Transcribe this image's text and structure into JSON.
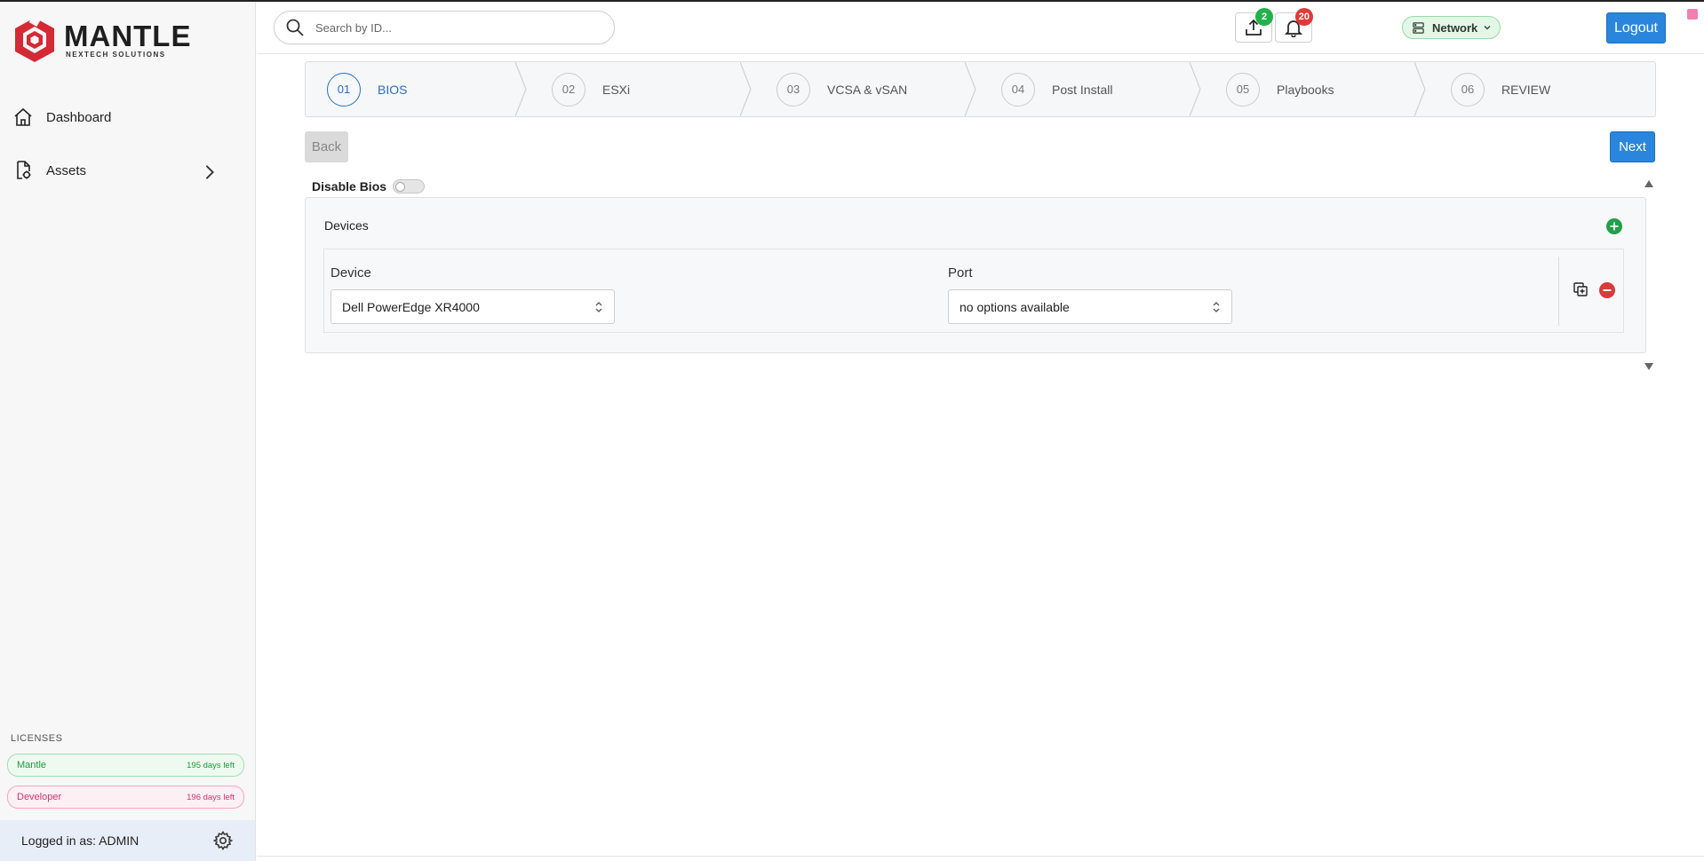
{
  "app": {
    "brand_title": "MANTLE",
    "brand_subtitle": "NEXTECH SOLUTIONS"
  },
  "sidebar": {
    "items": [
      {
        "label": "Dashboard",
        "icon": "home-icon"
      },
      {
        "label": "Assets",
        "icon": "assets-icon"
      }
    ],
    "licenses_label": "LICENSES",
    "licenses": [
      {
        "name": "Mantle",
        "days": "195 days left",
        "color": "#1f9a3a"
      },
      {
        "name": "Developer",
        "days": "196 days left",
        "color": "#d6336c"
      }
    ],
    "user_text": "Logged in as: ADMIN"
  },
  "header": {
    "search_placeholder": "Search by ID...",
    "network_label": "Network",
    "upload_badge": "2",
    "notifications_badge": "20",
    "logout_label": "Logout"
  },
  "stepper": {
    "steps": [
      {
        "num": "01",
        "label": "BIOS",
        "active": true
      },
      {
        "num": "02",
        "label": "ESXi",
        "active": false
      },
      {
        "num": "03",
        "label": "VCSA & vSAN",
        "active": false
      },
      {
        "num": "04",
        "label": "Post Install",
        "active": false
      },
      {
        "num": "05",
        "label": "Playbooks",
        "active": false
      },
      {
        "num": "06",
        "label": "REVIEW",
        "active": false
      }
    ]
  },
  "nav_buttons": {
    "back_label": "Back",
    "next_label": "Next"
  },
  "form": {
    "disable_bios_label": "Disable Bios",
    "disable_bios_on": false,
    "devices_title": "Devices",
    "device_label": "Device",
    "device_value": "Dell PowerEdge XR4000",
    "port_label": "Port",
    "port_value": "no options available"
  },
  "colors": {
    "accent": "#2a86dd",
    "active_step": "#2a6fc2",
    "add": "#22a04a",
    "remove": "#d93a3a",
    "brand_red": "#d42a36"
  }
}
